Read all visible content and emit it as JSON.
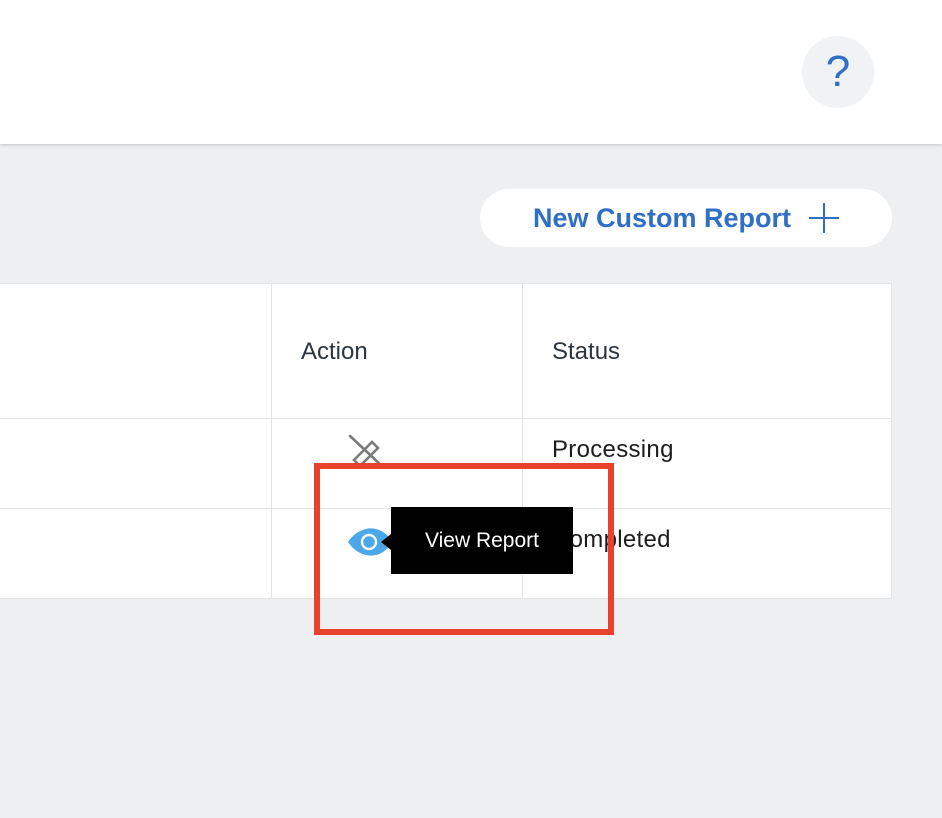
{
  "header": {
    "help_label": "?"
  },
  "toolbar": {
    "new_report_label": "New Custom Report",
    "new_report_icon": "plus-icon"
  },
  "table": {
    "columns": [
      "Action",
      "Status"
    ],
    "rows": [
      {
        "action_icon": "pencil-off-icon",
        "status": "Processing"
      },
      {
        "action_icon": "eye-icon",
        "status": "Completed"
      }
    ]
  },
  "tooltip": {
    "text": "View Report"
  },
  "colors": {
    "accent": "#2f6fc6",
    "eye_icon": "#4aa8e8",
    "highlight": "#e8412c",
    "background": "#eeeff1"
  }
}
